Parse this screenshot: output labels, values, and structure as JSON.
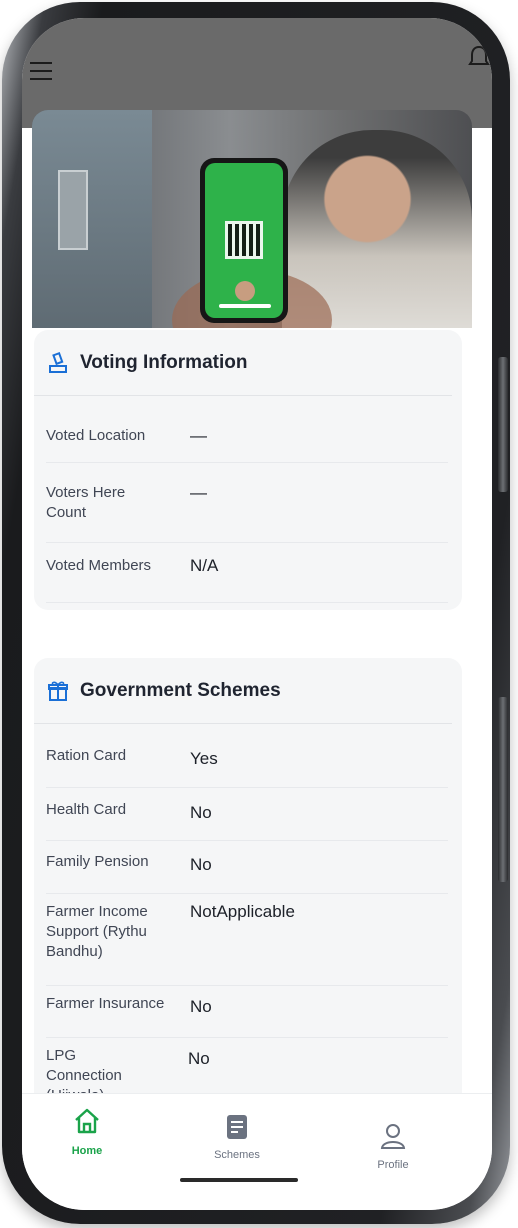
{
  "app": {
    "accent_color": "#1aa34a",
    "title_color": "#1f2430"
  },
  "topbar": {
    "menu_icon": "menu-icon",
    "bell_icon": "bell-icon"
  },
  "voting": {
    "title": "Voting Information",
    "icon": "ballot-icon",
    "rows": [
      {
        "label": "Voted Location",
        "value": "—"
      },
      {
        "label": "Voters Here Count",
        "value": "—"
      },
      {
        "label": "Voted Members",
        "value": "N/A"
      }
    ]
  },
  "schemes": {
    "title": "Government Schemes",
    "icon": "gift-icon",
    "rows": [
      {
        "label": "Ration Card",
        "value": "Yes"
      },
      {
        "label": "Health Card",
        "value": "No"
      },
      {
        "label": "Family Pension",
        "value": "No"
      },
      {
        "label": "Farmer Income Support (Rythu Bandhu)",
        "value": "NotApplicable"
      },
      {
        "label": "Farmer Insurance",
        "value": "No"
      },
      {
        "label": "LPG Connection (Ujjwala)",
        "value": "No"
      }
    ]
  },
  "nav": {
    "home": "Home",
    "schemes": "Schemes",
    "profile": "Profile"
  }
}
